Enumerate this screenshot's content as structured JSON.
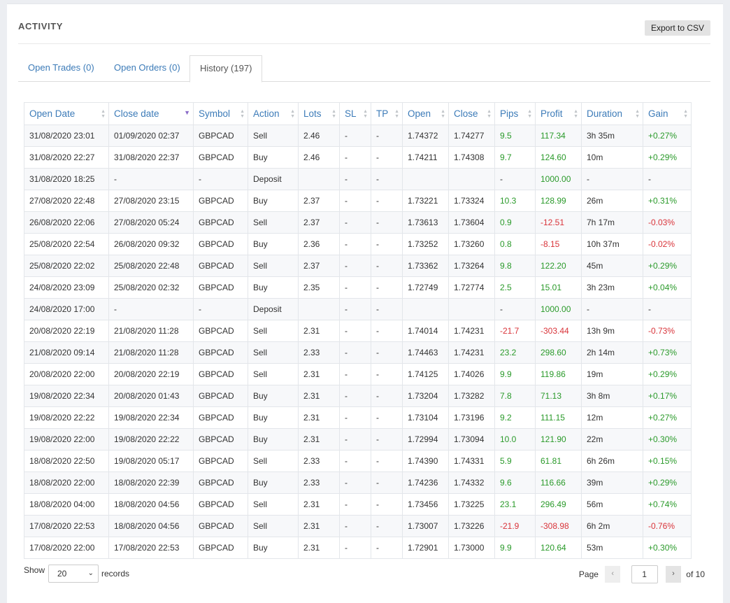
{
  "header": {
    "title": "ACTIVITY",
    "export_label": "Export to CSV"
  },
  "tabs": [
    {
      "label": "Open Trades (0)"
    },
    {
      "label": "Open Orders (0)"
    },
    {
      "label": "History (197)"
    }
  ],
  "columns": [
    "Open Date",
    "Close date",
    "Symbol",
    "Action",
    "Lots",
    "SL",
    "TP",
    "Open",
    "Close",
    "Pips",
    "Profit",
    "Duration",
    "Gain"
  ],
  "rows": [
    [
      "31/08/2020 23:01",
      "01/09/2020 02:37",
      "GBPCAD",
      "Sell",
      "2.46",
      "-",
      "-",
      "1.74372",
      "1.74277",
      "9.5",
      "117.34",
      "3h 35m",
      "+0.27%"
    ],
    [
      "31/08/2020 22:27",
      "31/08/2020 22:37",
      "GBPCAD",
      "Buy",
      "2.46",
      "-",
      "-",
      "1.74211",
      "1.74308",
      "9.7",
      "124.60",
      "10m",
      "+0.29%"
    ],
    [
      "31/08/2020 18:25",
      "-",
      "-",
      "Deposit",
      "",
      "-",
      "-",
      "",
      "",
      "-",
      "1000.00",
      "-",
      "-"
    ],
    [
      "27/08/2020 22:48",
      "27/08/2020 23:15",
      "GBPCAD",
      "Buy",
      "2.37",
      "-",
      "-",
      "1.73221",
      "1.73324",
      "10.3",
      "128.99",
      "26m",
      "+0.31%"
    ],
    [
      "26/08/2020 22:06",
      "27/08/2020 05:24",
      "GBPCAD",
      "Sell",
      "2.37",
      "-",
      "-",
      "1.73613",
      "1.73604",
      "0.9",
      "-12.51",
      "7h 17m",
      "-0.03%"
    ],
    [
      "25/08/2020 22:54",
      "26/08/2020 09:32",
      "GBPCAD",
      "Buy",
      "2.36",
      "-",
      "-",
      "1.73252",
      "1.73260",
      "0.8",
      "-8.15",
      "10h 37m",
      "-0.02%"
    ],
    [
      "25/08/2020 22:02",
      "25/08/2020 22:48",
      "GBPCAD",
      "Sell",
      "2.37",
      "-",
      "-",
      "1.73362",
      "1.73264",
      "9.8",
      "122.20",
      "45m",
      "+0.29%"
    ],
    [
      "24/08/2020 23:09",
      "25/08/2020 02:32",
      "GBPCAD",
      "Buy",
      "2.35",
      "-",
      "-",
      "1.72749",
      "1.72774",
      "2.5",
      "15.01",
      "3h 23m",
      "+0.04%"
    ],
    [
      "24/08/2020 17:00",
      "-",
      "-",
      "Deposit",
      "",
      "-",
      "-",
      "",
      "",
      "-",
      "1000.00",
      "-",
      "-"
    ],
    [
      "20/08/2020 22:19",
      "21/08/2020 11:28",
      "GBPCAD",
      "Sell",
      "2.31",
      "-",
      "-",
      "1.74014",
      "1.74231",
      "-21.7",
      "-303.44",
      "13h 9m",
      "-0.73%"
    ],
    [
      "21/08/2020 09:14",
      "21/08/2020 11:28",
      "GBPCAD",
      "Sell",
      "2.33",
      "-",
      "-",
      "1.74463",
      "1.74231",
      "23.2",
      "298.60",
      "2h 14m",
      "+0.73%"
    ],
    [
      "20/08/2020 22:00",
      "20/08/2020 22:19",
      "GBPCAD",
      "Sell",
      "2.31",
      "-",
      "-",
      "1.74125",
      "1.74026",
      "9.9",
      "119.86",
      "19m",
      "+0.29%"
    ],
    [
      "19/08/2020 22:34",
      "20/08/2020 01:43",
      "GBPCAD",
      "Buy",
      "2.31",
      "-",
      "-",
      "1.73204",
      "1.73282",
      "7.8",
      "71.13",
      "3h 8m",
      "+0.17%"
    ],
    [
      "19/08/2020 22:22",
      "19/08/2020 22:34",
      "GBPCAD",
      "Buy",
      "2.31",
      "-",
      "-",
      "1.73104",
      "1.73196",
      "9.2",
      "111.15",
      "12m",
      "+0.27%"
    ],
    [
      "19/08/2020 22:00",
      "19/08/2020 22:22",
      "GBPCAD",
      "Buy",
      "2.31",
      "-",
      "-",
      "1.72994",
      "1.73094",
      "10.0",
      "121.90",
      "22m",
      "+0.30%"
    ],
    [
      "18/08/2020 22:50",
      "19/08/2020 05:17",
      "GBPCAD",
      "Sell",
      "2.33",
      "-",
      "-",
      "1.74390",
      "1.74331",
      "5.9",
      "61.81",
      "6h 26m",
      "+0.15%"
    ],
    [
      "18/08/2020 22:00",
      "18/08/2020 22:39",
      "GBPCAD",
      "Buy",
      "2.33",
      "-",
      "-",
      "1.74236",
      "1.74332",
      "9.6",
      "116.66",
      "39m",
      "+0.29%"
    ],
    [
      "18/08/2020 04:00",
      "18/08/2020 04:56",
      "GBPCAD",
      "Sell",
      "2.31",
      "-",
      "-",
      "1.73456",
      "1.73225",
      "23.1",
      "296.49",
      "56m",
      "+0.74%"
    ],
    [
      "17/08/2020 22:53",
      "18/08/2020 04:56",
      "GBPCAD",
      "Sell",
      "2.31",
      "-",
      "-",
      "1.73007",
      "1.73226",
      "-21.9",
      "-308.98",
      "6h 2m",
      "-0.76%"
    ],
    [
      "17/08/2020 22:00",
      "17/08/2020 22:53",
      "GBPCAD",
      "Buy",
      "2.31",
      "-",
      "-",
      "1.72901",
      "1.73000",
      "9.9",
      "120.64",
      "53m",
      "+0.30%"
    ]
  ],
  "footer": {
    "show_label": "Show",
    "page_size": "20",
    "records_label": "records",
    "page_label": "Page",
    "page_value": "1",
    "of_label": "of 10",
    "prev_icon": "‹",
    "next_icon": "›"
  },
  "colors": {
    "link": "#3c7bb8",
    "positive": "#2a9a2a",
    "negative": "#d9343a"
  }
}
